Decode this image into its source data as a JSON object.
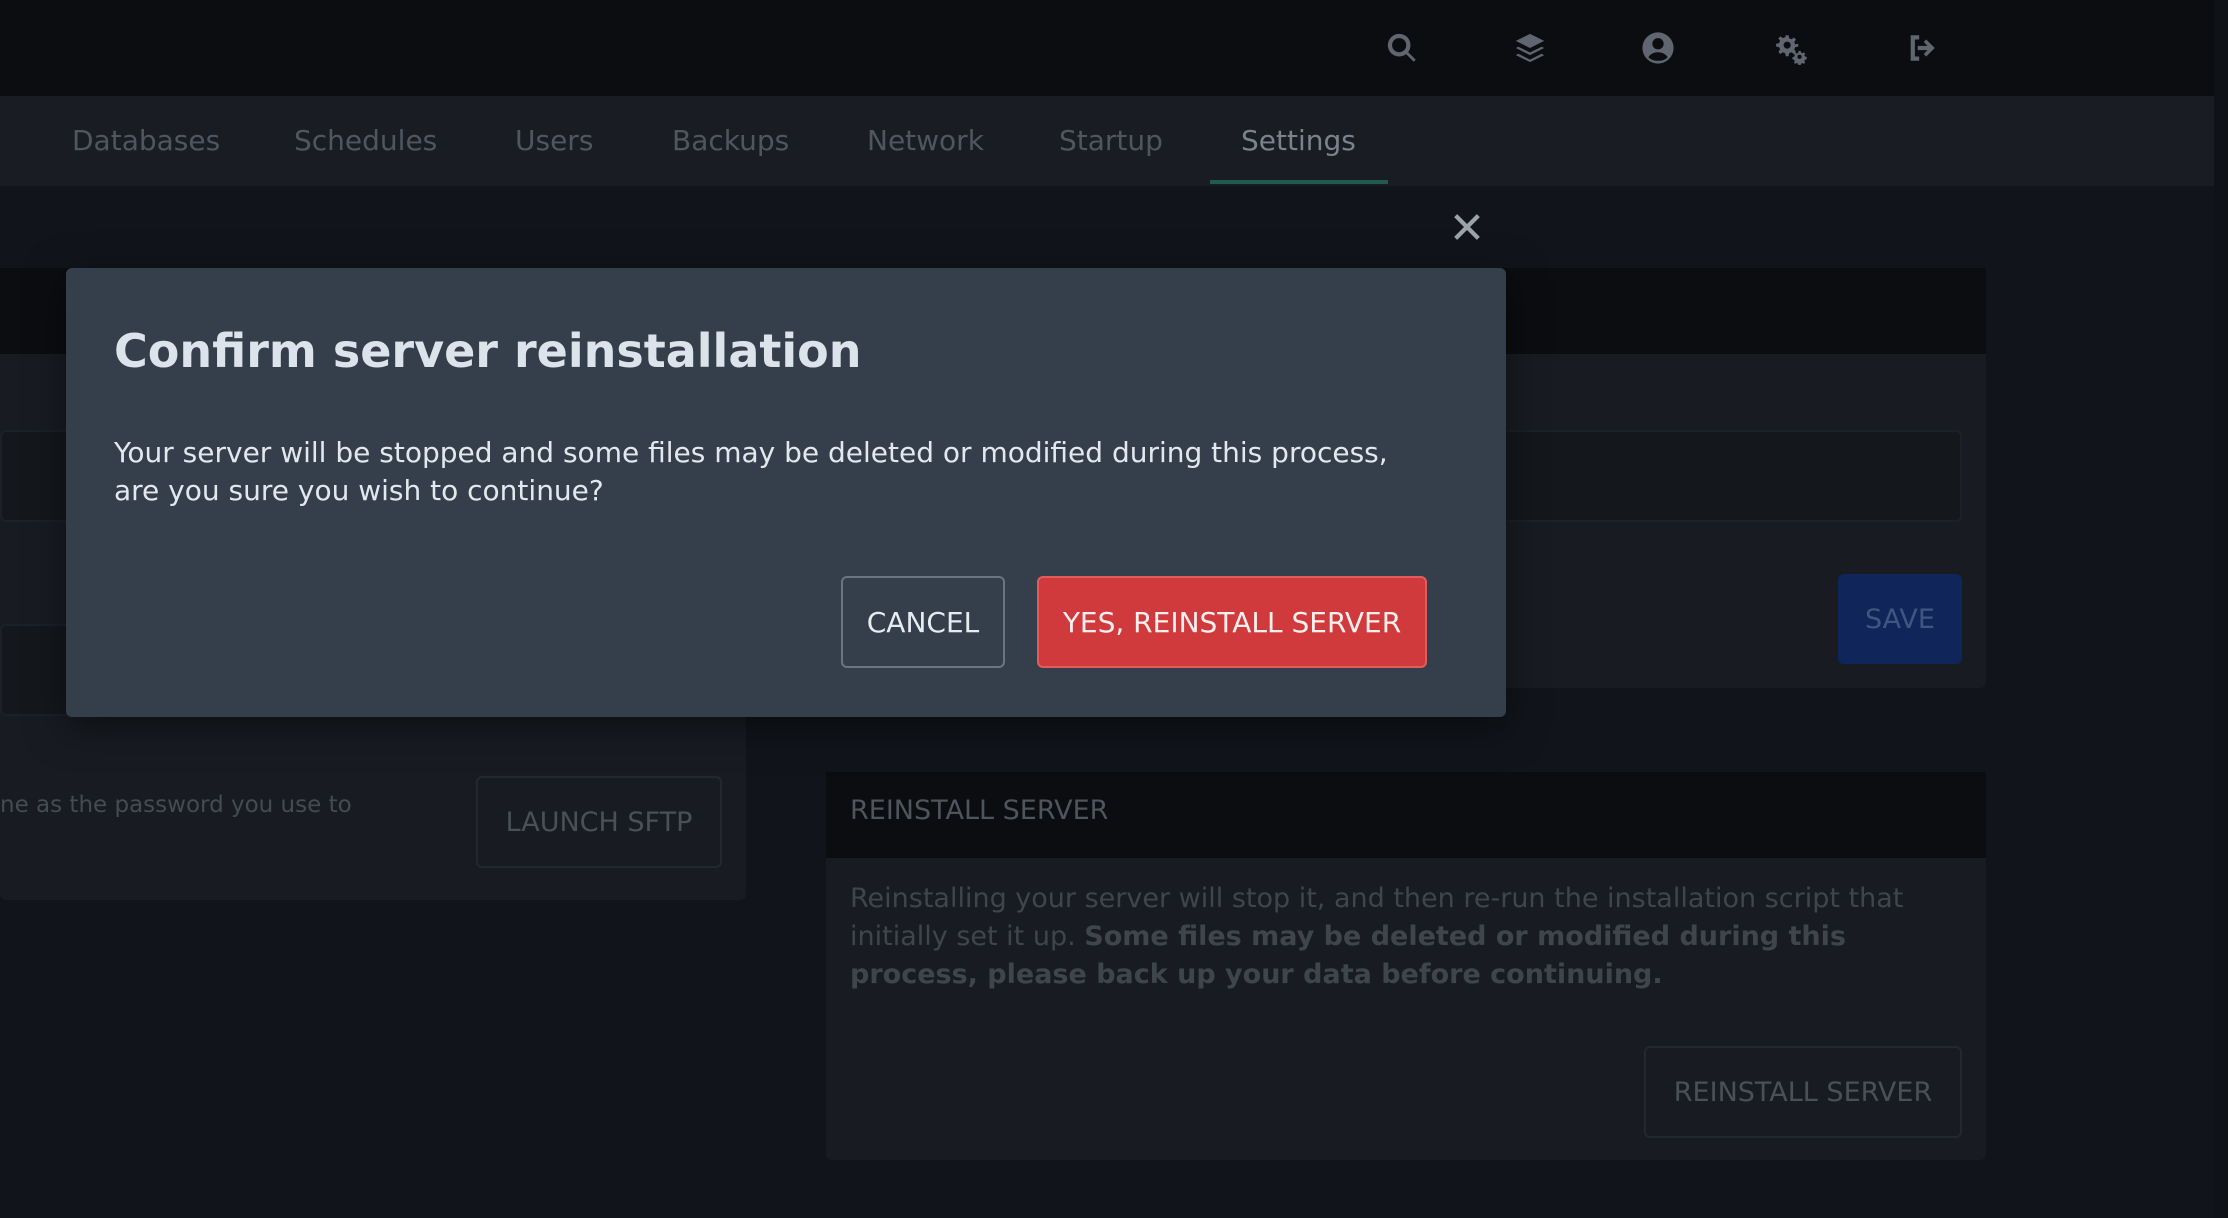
{
  "topbar": {
    "icons": [
      "search-icon",
      "layers-icon",
      "user-circle-icon",
      "cogs-icon",
      "sign-out-icon"
    ]
  },
  "nav": {
    "tabs": [
      {
        "label": "Databases"
      },
      {
        "label": "Schedules"
      },
      {
        "label": "Users"
      },
      {
        "label": "Backups"
      },
      {
        "label": "Network"
      },
      {
        "label": "Startup"
      },
      {
        "label": "Settings",
        "active": true
      }
    ]
  },
  "background": {
    "save_label": "SAVE",
    "sftp_text": "ne as the password you use to",
    "launch_sftp_label": "LAUNCH SFTP",
    "reinstall_card": {
      "title": "REINSTALL SERVER",
      "text_normal": "Reinstalling your server will stop it, and then re-run the installation script that initially set it up.",
      "text_bold": "Some files may be deleted or modified during this process, please back up your data before continuing.",
      "button_label": "REINSTALL SERVER"
    }
  },
  "modal": {
    "title": "Confirm server reinstallation",
    "body": "Your server will be stopped and some files may be deleted or modified during this process, are you sure you wish to continue?",
    "cancel_label": "CANCEL",
    "confirm_label": "YES, REINSTALL SERVER"
  },
  "colors": {
    "accent_active_tab": "#1f5c4d",
    "danger": "#d03a3d",
    "modal_bg": "#353f4c",
    "primary_dim": "#10255a"
  }
}
